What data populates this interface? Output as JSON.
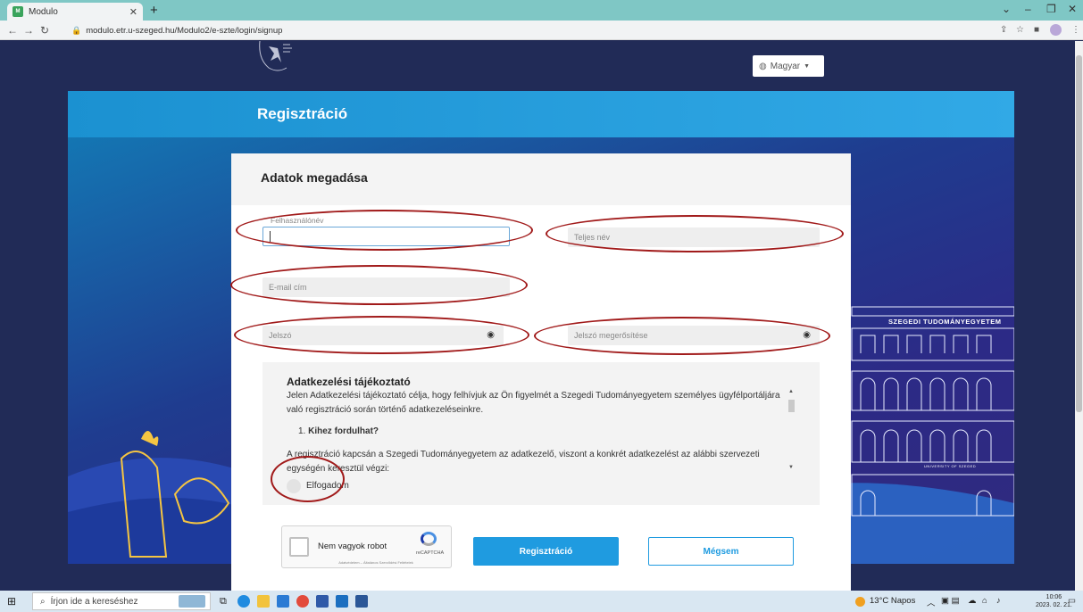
{
  "browser": {
    "tab_title": "Modulo",
    "favicon_text": "M",
    "url": "modulo.etr.u-szeged.hu/Modulo2/e-szte/login/signup",
    "new_tab": "+"
  },
  "header": {
    "language_label": "Magyar",
    "page_title": "Regisztráció"
  },
  "form": {
    "title": "Adatok megadása",
    "username_label": "Felhasználónév",
    "fullname_placeholder": "Teljes név",
    "email_placeholder": "E-mail cím",
    "password_placeholder": "Jelszó",
    "password_confirm_placeholder": "Jelszó megerősítése"
  },
  "privacy": {
    "title": "Adatkezelési tájékoztató",
    "paragraph": "Jelen Adatkezelési tájékoztató célja, hogy felhívjuk az Ön figyelmét a Szegedi Tudományegyetem személyes ügyfélportáljára való regisztráció során történő adatkezeléseinkre.",
    "list_item_number": "1.",
    "list_item": "Kihez fordulhat?",
    "paragraph2": "A regisztráció kapcsán a Szegedi Tudományegyetem az adatkezelő, viszont a konkrét adatkezelést az alábbi szervezeti egységén keresztül végzi:",
    "accept_label": "Elfogadom"
  },
  "captcha": {
    "label": "Nem vagyok robot",
    "brand": "reCAPTCHA",
    "terms": "Adatvédelem – Általános Szerződési Feltételek"
  },
  "buttons": {
    "register": "Regisztráció",
    "cancel": "Mégsem"
  },
  "background": {
    "building_title": "SZEGEDI TUDOMÁNYEGYETEM",
    "university_label": "UNIVERSITY OF SZEGED"
  },
  "taskbar": {
    "search_placeholder": "Írjon ide a kereséshez",
    "weather": "13°C Napos",
    "time": "10:06",
    "date": "2023. 02. 21."
  },
  "colors": {
    "accent": "#1f9be0",
    "highlight_oval": "#a11a1a",
    "page_bg": "#212b57"
  }
}
